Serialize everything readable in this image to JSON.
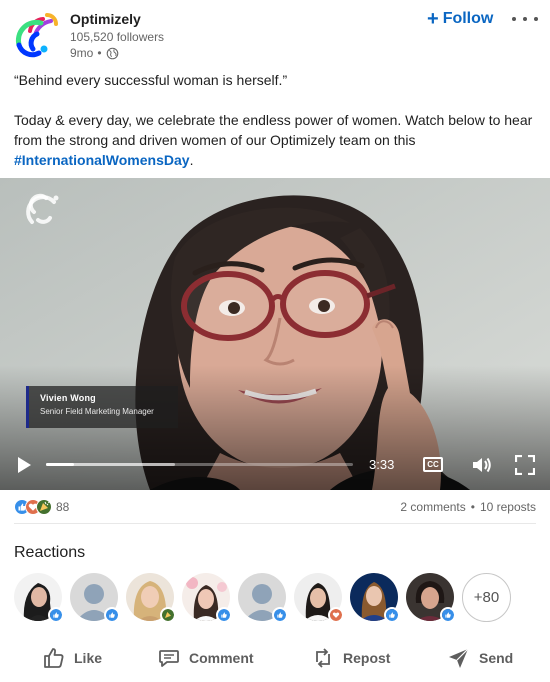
{
  "header": {
    "company_name": "Optimizely",
    "followers": "105,520 followers",
    "time": "9mo",
    "time_separator": "•",
    "follow_label": "Follow",
    "follow_plus": "+"
  },
  "post": {
    "quote": "“Behind every successful woman is herself.”",
    "body": "Today & every day, we celebrate the endless power of women. Watch below to hear from the strong and driven women of our Optimizely team on this ",
    "hashtag": "#InternationalWomensDay",
    "body_end": "."
  },
  "video": {
    "lower_third_name": "Vivien Wong",
    "lower_third_title": "Senior Field Marketing Manager",
    "duration": "3:33",
    "cc_label": "CC",
    "played_fraction": 0.09,
    "buffered_fraction": 0.42
  },
  "social": {
    "reaction_icons": [
      "like-icon",
      "love-icon",
      "celebrate-icon"
    ],
    "reactions_count": "88",
    "comments": "2 comments",
    "separator": "•",
    "reposts": "10 reposts"
  },
  "reactions": {
    "heading": "Reactions",
    "more_label": "+80",
    "people": [
      {
        "badge": "like",
        "avatar": "woman-dark-hair"
      },
      {
        "badge": "like",
        "avatar": "default-ghost"
      },
      {
        "badge": "celebrate",
        "avatar": "woman-blonde"
      },
      {
        "badge": "like",
        "avatar": "woman-flowers"
      },
      {
        "badge": "like",
        "avatar": "default-ghost"
      },
      {
        "badge": "love",
        "avatar": "woman-dark-hair-smile"
      },
      {
        "badge": "like",
        "avatar": "woman-blue-background"
      },
      {
        "badge": "like",
        "avatar": "woman-short-hair"
      }
    ]
  },
  "actions": {
    "like": "Like",
    "comment": "Comment",
    "repost": "Repost",
    "send": "Send"
  },
  "colors": {
    "link_blue": "#0a66c2",
    "like_blue": "#378fe9",
    "love_red": "#df704d",
    "celebrate_green": "#44712e",
    "text_muted": "#666666"
  }
}
